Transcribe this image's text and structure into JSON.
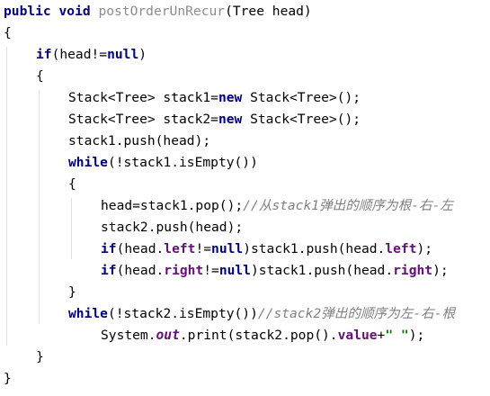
{
  "editor": {
    "language": "java",
    "lines": [
      {
        "indent": 0,
        "tokens": [
          {
            "t": "kw",
            "v": "public"
          },
          {
            "t": "tx",
            "v": " "
          },
          {
            "t": "kw",
            "v": "void"
          },
          {
            "t": "tx",
            "v": " "
          },
          {
            "t": "fn",
            "v": "postOrderUnRecur"
          },
          {
            "t": "tx",
            "v": "(Tree head)"
          }
        ]
      },
      {
        "indent": 0,
        "tokens": [
          {
            "t": "tx",
            "v": "{"
          }
        ]
      },
      {
        "indent": 1,
        "tokens": [
          {
            "t": "kw",
            "v": "if"
          },
          {
            "t": "tx",
            "v": "(head!="
          },
          {
            "t": "kw",
            "v": "null"
          },
          {
            "t": "tx",
            "v": ")"
          }
        ]
      },
      {
        "indent": 1,
        "tokens": [
          {
            "t": "tx",
            "v": "{"
          }
        ]
      },
      {
        "indent": 2,
        "tokens": [
          {
            "t": "tx",
            "v": "Stack<Tree> stack1="
          },
          {
            "t": "kw",
            "v": "new"
          },
          {
            "t": "tx",
            "v": " Stack<Tree>();"
          }
        ]
      },
      {
        "indent": 2,
        "tokens": [
          {
            "t": "tx",
            "v": "Stack<Tree> stack2="
          },
          {
            "t": "kw",
            "v": "new"
          },
          {
            "t": "tx",
            "v": " Stack<Tree>();"
          }
        ]
      },
      {
        "indent": 2,
        "tokens": [
          {
            "t": "tx",
            "v": "stack1.push(head);"
          }
        ]
      },
      {
        "indent": 2,
        "tokens": [
          {
            "t": "kw",
            "v": "while"
          },
          {
            "t": "tx",
            "v": "(!stack1.isEmpty())"
          }
        ]
      },
      {
        "indent": 2,
        "tokens": [
          {
            "t": "tx",
            "v": "{"
          }
        ]
      },
      {
        "indent": 3,
        "tokens": [
          {
            "t": "tx",
            "v": "head=stack1.pop();"
          },
          {
            "t": "cm",
            "v": "//从stack1弹出的顺序为根-右-左"
          }
        ]
      },
      {
        "indent": 3,
        "tokens": [
          {
            "t": "tx",
            "v": "stack2.push(head);"
          }
        ]
      },
      {
        "indent": 3,
        "tokens": [
          {
            "t": "kw",
            "v": "if"
          },
          {
            "t": "tx",
            "v": "(head."
          },
          {
            "t": "fld",
            "v": "left"
          },
          {
            "t": "tx",
            "v": "!="
          },
          {
            "t": "kw",
            "v": "null"
          },
          {
            "t": "tx",
            "v": ")stack1.push(head."
          },
          {
            "t": "fld",
            "v": "left"
          },
          {
            "t": "tx",
            "v": ");"
          }
        ]
      },
      {
        "indent": 3,
        "tokens": [
          {
            "t": "kw",
            "v": "if"
          },
          {
            "t": "tx",
            "v": "(head."
          },
          {
            "t": "fld",
            "v": "right"
          },
          {
            "t": "tx",
            "v": "!="
          },
          {
            "t": "kw",
            "v": "null"
          },
          {
            "t": "tx",
            "v": ")stack1.push(head."
          },
          {
            "t": "fld",
            "v": "right"
          },
          {
            "t": "tx",
            "v": ");"
          }
        ]
      },
      {
        "indent": 2,
        "tokens": [
          {
            "t": "tx",
            "v": "}"
          }
        ]
      },
      {
        "indent": 2,
        "tokens": [
          {
            "t": "kw",
            "v": "while"
          },
          {
            "t": "tx",
            "v": "(!stack2.isEmpty())"
          },
          {
            "t": "cm",
            "v": "//stack2弹出的顺序为左-右-根"
          }
        ]
      },
      {
        "indent": 3,
        "tokens": [
          {
            "t": "tx",
            "v": "System."
          },
          {
            "t": "sf",
            "v": "out"
          },
          {
            "t": "tx",
            "v": ".print(stack2.pop()."
          },
          {
            "t": "fld",
            "v": "value"
          },
          {
            "t": "tx",
            "v": "+"
          },
          {
            "t": "str",
            "v": "\" \""
          },
          {
            "t": "tx",
            "v": ");"
          }
        ]
      },
      {
        "indent": 1,
        "tokens": [
          {
            "t": "tx",
            "v": "}"
          }
        ]
      },
      {
        "indent": 0,
        "tokens": [
          {
            "t": "tx",
            "v": "}"
          }
        ]
      }
    ],
    "colors": {
      "background": "#ffffff",
      "keyword": "#000080",
      "method_declaration": "#8c8c8c",
      "comment": "#808080",
      "field": "#660e7a",
      "string": "#008000",
      "indent_guide": "#dedede",
      "plain_text": "#000000"
    }
  }
}
